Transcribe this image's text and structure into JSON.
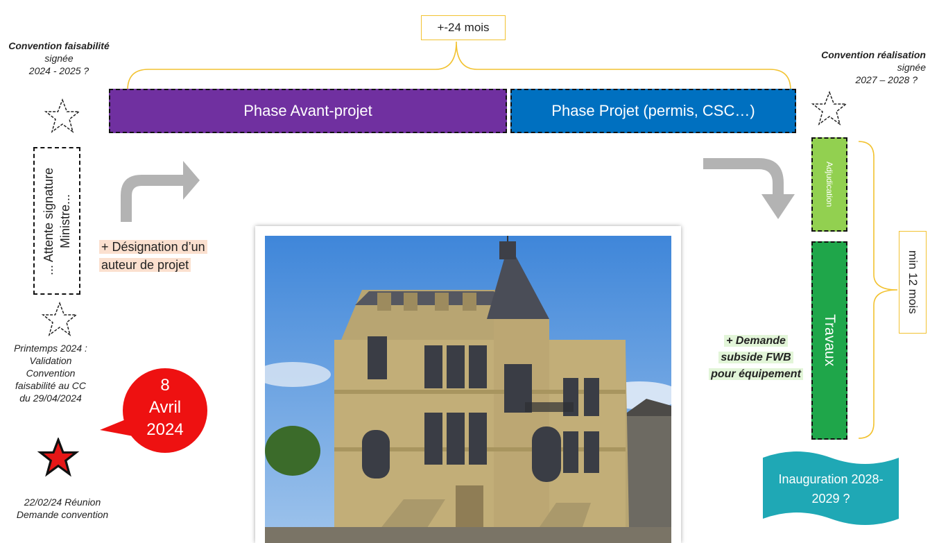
{
  "duration_label": "+-24 mois",
  "left": {
    "convention_bold": "Convention faisabilité",
    "convention_rest": " signée",
    "convention_dates": "2024 - 2025 ?",
    "waiting_box": "... Attente signature Ministre...",
    "spring_note": "Printemps 2024 : Validation Convention faisabilité au CC du 29/04/2024",
    "meeting_note": "22/02/24 Réunion Demande convention"
  },
  "date_bubble": {
    "day": "8",
    "month": "Avril",
    "year": "2024"
  },
  "designation_note": "+  Désignation d’un auteur de projet",
  "phases": {
    "avant_projet": "Phase Avant-projet",
    "projet": "Phase Projet (permis, CSC…)"
  },
  "right": {
    "convention_bold": "Convention réalisation",
    "convention_rest": " signée",
    "convention_dates": "2027 – 2028 ?",
    "adjudication": "Adjudication",
    "travaux": "Travaux",
    "min_duration": "min 12 mois",
    "subsidy_note": "+ Demande subside FWB pour équipement",
    "inauguration": "Inauguration 2028-2029 ?"
  },
  "colors": {
    "avant_projet": "#7030a0",
    "projet": "#0070c0",
    "adjudication": "#92d050",
    "travaux": "#1fa64a",
    "bubble": "#ee1111",
    "inauguration": "#1fa8b5",
    "bracket": "#f2c230",
    "designation_bg": "#fbe0cf",
    "subsidy_bg": "#e2f5d8",
    "arrow": "#b3b3b3"
  },
  "icons": [
    "star-outline-icon",
    "star-filled-icon",
    "curved-arrow-up-right-icon",
    "curved-arrow-down-right-icon"
  ]
}
